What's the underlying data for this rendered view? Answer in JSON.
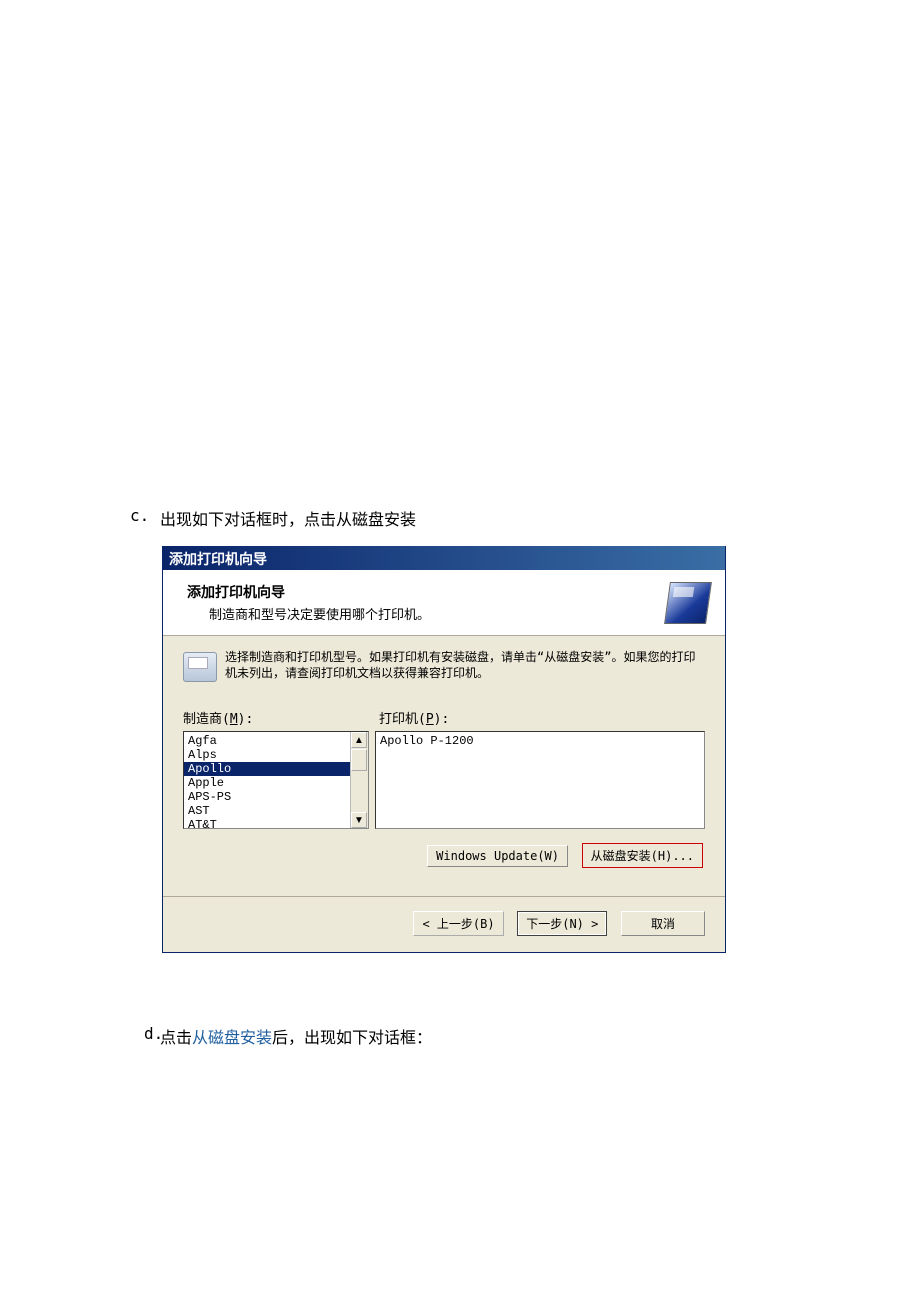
{
  "steps": {
    "c": {
      "marker": "c.",
      "text": "出现如下对话框时，点击从磁盘安装"
    },
    "d": {
      "marker": "d.",
      "prefix": "点击",
      "link": "从磁盘安装",
      "suffix": "后，出现如下对话框："
    }
  },
  "dialog": {
    "title": "添加打印机向导",
    "header_title": "添加打印机向导",
    "header_sub": "制造商和型号决定要使用哪个打印机。",
    "instruction": "选择制造商和打印机型号。如果打印机有安装磁盘，请单击“从磁盘安装”。如果您的打印机未列出，请查阅打印机文档以获得兼容打印机。",
    "mfg_label_pre": "制造商(",
    "mfg_label_u": "M",
    "mfg_label_post": "):",
    "printer_label_pre": "打印机(",
    "printer_label_u": "P",
    "printer_label_post": "):",
    "manufacturers": [
      "Agfa",
      "Alps",
      "Apollo",
      "Apple",
      "APS-PS",
      "AST",
      "AT&T"
    ],
    "selected_mfg_index": 2,
    "printers": [
      "Apollo P-1200"
    ],
    "buttons": {
      "windows_update": "Windows Update(W)",
      "have_disk": "从磁盘安装(H)...",
      "back": "< 上一步(B)",
      "next": "下一步(N) >",
      "cancel": "取消"
    }
  }
}
